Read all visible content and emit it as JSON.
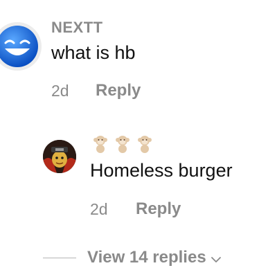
{
  "comment": {
    "username": "NEXTT",
    "text": "what is hb",
    "time": "2d",
    "reply_label": "Reply",
    "avatar_icon": "laughing-emoji-avatar"
  },
  "reply": {
    "username_emojis": [
      "monkey-emoji",
      "monkey-emoji",
      "monkey-emoji"
    ],
    "text": "Homeless burger",
    "time": "2d",
    "reply_label": "Reply",
    "avatar_icon": "character-avatar"
  },
  "thread": {
    "view_replies_label": "View 14 replies",
    "chevron_icon": "chevron-down-icon"
  },
  "colors": {
    "muted_text": "#8a8a8a",
    "body_text": "#111111",
    "background": "#ffffff"
  }
}
